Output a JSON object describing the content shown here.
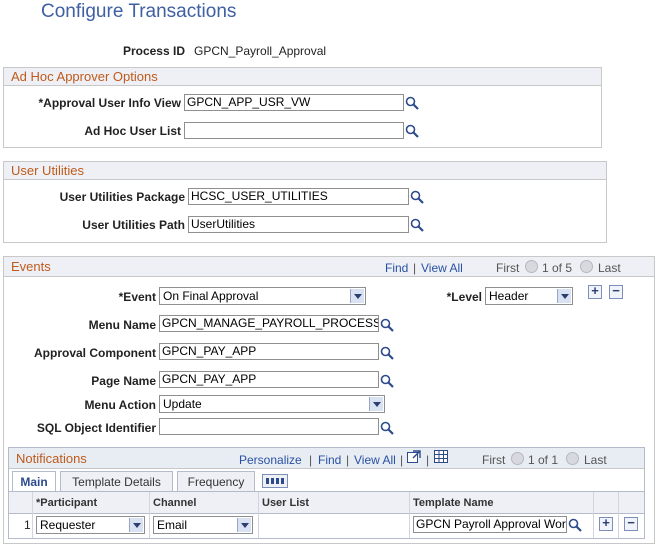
{
  "page_title": "Configure Transactions",
  "process_id": {
    "label": "Process ID",
    "value": "GPCN_Payroll_Approval"
  },
  "ad_hoc": {
    "section_title": "Ad Hoc Approver Options",
    "approval_user_info_view": {
      "label": "*Approval User Info View",
      "value": "GPCN_APP_USR_VW"
    },
    "ad_hoc_user_list": {
      "label": "Ad Hoc User List",
      "value": ""
    }
  },
  "user_utilities": {
    "section_title": "User Utilities",
    "package": {
      "label": "User Utilities Package",
      "value": "HCSC_USER_UTILITIES"
    },
    "path": {
      "label": "User Utilities Path",
      "value": "UserUtilities"
    }
  },
  "events": {
    "section_title": "Events",
    "find": "Find",
    "separator": "|",
    "view_all": "View All",
    "first": "First",
    "counter": "1 of 5",
    "last": "Last",
    "event": {
      "label": "*Event",
      "value": "On Final Approval"
    },
    "level": {
      "label": "*Level",
      "value": "Header"
    },
    "menu_name": {
      "label": "Menu Name",
      "value": "GPCN_MANAGE_PAYROLL_PROCESS"
    },
    "approval_component": {
      "label": "Approval Component",
      "value": "GPCN_PAY_APP"
    },
    "page_name": {
      "label": "Page Name",
      "value": "GPCN_PAY_APP"
    },
    "menu_action": {
      "label": "Menu Action",
      "value": "Update"
    },
    "sql_object_identifier": {
      "label": "SQL Object Identifier",
      "value": ""
    }
  },
  "notifications": {
    "section_title": "Notifications",
    "personalize": "Personalize",
    "find": "Find",
    "view_all": "View All",
    "first": "First",
    "counter": "1 of 1",
    "last": "Last",
    "tabs": [
      "Main",
      "Template Details",
      "Frequency"
    ],
    "columns": [
      "*Participant",
      "Channel",
      "User List",
      "Template Name"
    ],
    "rows": [
      {
        "num": "1",
        "participant": "Requester",
        "channel": "Email",
        "user_list": "",
        "template_name": "GPCN Payroll Approval Work"
      }
    ]
  }
}
